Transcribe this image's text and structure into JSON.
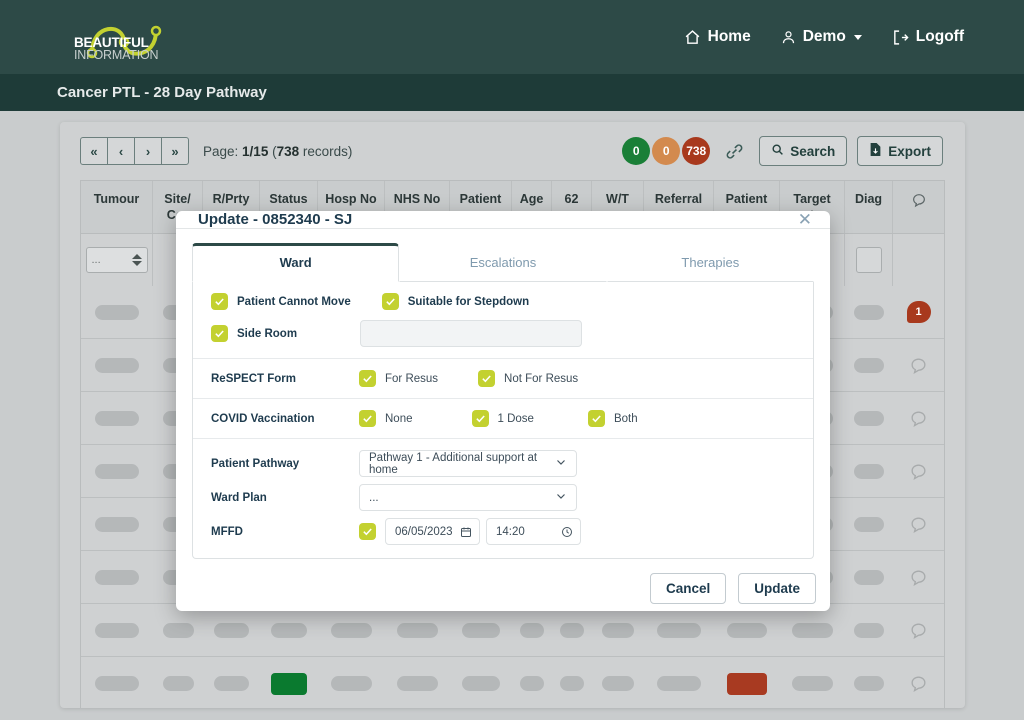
{
  "brand": {
    "line1": "BEAUTIFUL",
    "line2": "INFORMATION",
    "accent_color": "#c3d130",
    "header_color": "#2d4a47"
  },
  "nav": {
    "items": [
      {
        "label": "Home",
        "icon": "home-icon"
      },
      {
        "label": "Demo",
        "icon": "user-icon",
        "has_caret": true
      },
      {
        "label": "Logoff",
        "icon": "logout-icon"
      }
    ]
  },
  "subheader": {
    "title": "Cancer PTL - 28 Day Pathway"
  },
  "toolbar": {
    "pager": {
      "first": "«",
      "prev": "‹",
      "next": "›",
      "last": "»"
    },
    "page_prefix": "Page:",
    "page_value": "1/15",
    "records_count": "738",
    "records_suffix": "records",
    "badges": [
      {
        "value": "0",
        "color": "#1a7f37"
      },
      {
        "value": "0",
        "color": "#d38a4e"
      },
      {
        "value": "738",
        "color": "#a8391d"
      }
    ],
    "link_icon": "link-icon",
    "search_label": "Search",
    "export_label": "Export"
  },
  "table": {
    "columns": [
      {
        "label": "Tumour",
        "width": 72
      },
      {
        "label": "Site/ Cor",
        "width": 50
      },
      {
        "label": "R/Prty",
        "width": 57
      },
      {
        "label": "Status",
        "width": 58
      },
      {
        "label": "Hosp No",
        "width": 67
      },
      {
        "label": "NHS No",
        "width": 65
      },
      {
        "label": "Patient",
        "width": 62
      },
      {
        "label": "Age",
        "width": 40
      },
      {
        "label": "62",
        "width": 40
      },
      {
        "label": "W/T",
        "width": 52
      },
      {
        "label": "Referral",
        "width": 70
      },
      {
        "label": "Patient",
        "width": 66
      },
      {
        "label": "Target ate",
        "width": 65
      },
      {
        "label": "Diag",
        "width": 48
      },
      {
        "label": "🗪",
        "width": 51
      }
    ],
    "filter_placeholder": "...",
    "rows": [
      {
        "comment": {
          "type": "badge",
          "value": "1"
        }
      },
      {
        "comment": {
          "type": "outline"
        }
      },
      {
        "comment": {
          "type": "outline"
        }
      },
      {
        "comment": {
          "type": "outline"
        }
      },
      {
        "comment": {
          "type": "outline"
        }
      },
      {
        "comment": {
          "type": "outline"
        }
      },
      {
        "comment": {
          "type": "outline"
        }
      },
      {
        "comment": {
          "type": "outline"
        },
        "highlights": {
          "3": "green",
          "11": "red"
        }
      }
    ]
  },
  "modal": {
    "title": "Update - 0852340 - SJ",
    "close_icon": "close-icon",
    "tabs": [
      {
        "label": "Ward",
        "active": true
      },
      {
        "label": "Escalations",
        "active": false
      },
      {
        "label": "Therapies",
        "active": false
      }
    ],
    "ward": {
      "checkboxes_top": [
        {
          "label": "Patient Cannot Move",
          "checked": true
        },
        {
          "label": "Suitable for Stepdown",
          "checked": true
        }
      ],
      "side_room": {
        "label": "Side Room",
        "checked": true,
        "note_value": "",
        "note_placeholder": ""
      },
      "respect": {
        "label": "ReSPECT Form",
        "options": [
          {
            "label": "For Resus",
            "checked": true
          },
          {
            "label": "Not For Resus",
            "checked": true
          }
        ]
      },
      "covid": {
        "label": "COVID Vaccination",
        "options": [
          {
            "label": "None",
            "checked": true
          },
          {
            "label": "1 Dose",
            "checked": true
          },
          {
            "label": "Both",
            "checked": true
          }
        ]
      },
      "patient_pathway": {
        "label": "Patient Pathway",
        "value": "Pathway 1 - Additional support at home"
      },
      "ward_plan": {
        "label": "Ward Plan",
        "value": "..."
      },
      "mffd": {
        "label": "MFFD",
        "checked": true,
        "date_value": "06/05/2023",
        "time_value": "14:20",
        "date_icon": "calendar-icon",
        "time_icon": "clock-icon"
      }
    },
    "footer": {
      "cancel_label": "Cancel",
      "update_label": "Update"
    }
  }
}
